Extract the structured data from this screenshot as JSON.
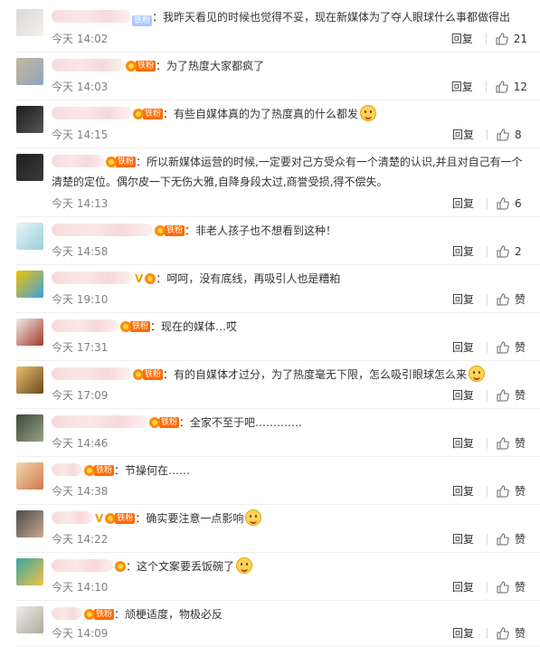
{
  "comments": [
    {
      "name_w": 88,
      "vip": false,
      "badge": "blue",
      "badge_text": "铁粉",
      "text": "我昨天看见的时候也觉得不妥，现在新媒体为了夺人眼球什么事都做得出",
      "emoji": false,
      "time": "今天 14:02",
      "reply": "回复",
      "likes": "21",
      "avatar": [
        "#d8d8d8",
        "#f5f1ea"
      ]
    },
    {
      "name_w": 80,
      "vip": false,
      "badge": "orange",
      "badge_text": "铁粉",
      "text": "为了热度大家都疯了",
      "emoji": false,
      "time": "今天 14:03",
      "reply": "回复",
      "likes": "12",
      "avatar": [
        "#c9b79a",
        "#8ea4c0"
      ]
    },
    {
      "name_w": 88,
      "vip": false,
      "badge": "orange",
      "badge_text": "铁粉",
      "text": "有些自媒体真的为了热度真的什么都发",
      "emoji": true,
      "time": "今天 14:15",
      "reply": "回复",
      "likes": "8",
      "avatar": [
        "#1c1c1c",
        "#555555"
      ]
    },
    {
      "name_w": 58,
      "vip": false,
      "badge": "orange",
      "badge_text": "铁粉",
      "text": "所以新媒体运营的时候,一定要对己方受众有一个清楚的认识,并且对自己有一个清楚的定位。偶尔皮一下无伤大雅,自降身段太过,商誉受损,得不偿失。",
      "emoji": false,
      "time": "今天 14:13",
      "reply": "回复",
      "likes": "6",
      "avatar": [
        "#202020",
        "#3a3a3a"
      ]
    },
    {
      "name_w": 112,
      "vip": false,
      "badge": "orange",
      "badge_text": "铁粉",
      "text": "非老人孩子也不想看到这种！",
      "emoji": false,
      "time": "今天 14:58",
      "reply": "回复",
      "likes": "2",
      "avatar": [
        "#e7f4f6",
        "#9ad0dc"
      ]
    },
    {
      "name_w": 90,
      "vip": true,
      "badge": "orange",
      "badge_text": "",
      "text": "呵呵，没有底线，再吸引人也是糟粕",
      "emoji": false,
      "time": "今天 19:10",
      "reply": "回复",
      "likes": "赞",
      "avatar": [
        "#f2c300",
        "#3aa0e0"
      ]
    },
    {
      "name_w": 74,
      "vip": false,
      "badge": "orange",
      "badge_text": "铁粉",
      "text": "现在的媒体…哎",
      "emoji": false,
      "time": "今天 17:31",
      "reply": "回复",
      "likes": "赞",
      "avatar": [
        "#f1ece8",
        "#a23a2a"
      ]
    },
    {
      "name_w": 88,
      "vip": false,
      "badge": "orange",
      "badge_text": "铁粉",
      "text": "有的自媒体才过分，为了热度毫无下限，怎么吸引眼球怎么来",
      "emoji": true,
      "time": "今天 17:09",
      "reply": "回复",
      "likes": "赞",
      "avatar": [
        "#e8c070",
        "#6b4a1a"
      ]
    },
    {
      "name_w": 106,
      "vip": false,
      "badge": "orange",
      "badge_text": "铁粉",
      "text": "全家不至于吧………….",
      "emoji": false,
      "time": "今天 14:46",
      "reply": "回复",
      "likes": "赞",
      "avatar": [
        "#3a4a36",
        "#9aa08a"
      ]
    },
    {
      "name_w": 34,
      "vip": false,
      "badge": "orange",
      "badge_text": "铁粉",
      "text": "节操何在……",
      "emoji": false,
      "time": "今天 14:38",
      "reply": "回复",
      "likes": "赞",
      "avatar": [
        "#f3d7b0",
        "#d07a4a"
      ]
    },
    {
      "name_w": 46,
      "vip": true,
      "badge": "orange",
      "badge_text": "铁粉",
      "text": "确实要注意一点影响",
      "emoji": true,
      "time": "今天 14:22",
      "reply": "回复",
      "likes": "赞",
      "avatar": [
        "#4a4a4a",
        "#c8a890"
      ]
    },
    {
      "name_w": 68,
      "vip": false,
      "badge": "orange",
      "badge_text": "",
      "text": "这个文案要丢饭碗了",
      "emoji": true,
      "time": "今天 14:10",
      "reply": "回复",
      "likes": "赞",
      "avatar": [
        "#3aa6a0",
        "#f1c24a"
      ]
    },
    {
      "name_w": 34,
      "vip": false,
      "badge": "orange",
      "badge_text": "铁粉",
      "text": "颃梗适度，物极必反",
      "emoji": false,
      "time": "今天 14:09",
      "reply": "回复",
      "likes": "赞",
      "avatar": [
        "#eeeeee",
        "#b0a89a"
      ]
    }
  ]
}
